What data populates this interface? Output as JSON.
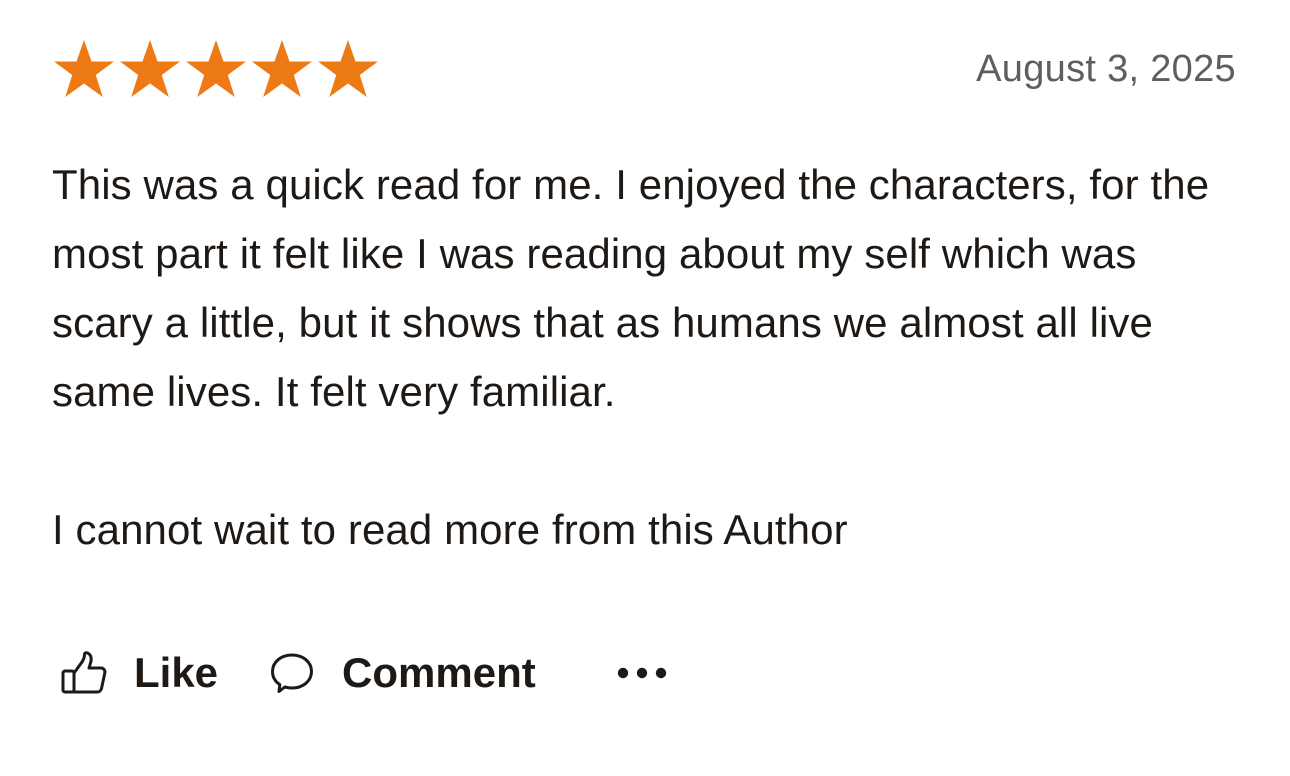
{
  "review": {
    "rating": 5,
    "rating_max": 5,
    "star_color": "#ee7a16",
    "date": "August 3, 2025",
    "paragraphs": [
      "This was a quick read for me. I enjoyed the characters, for the most part it felt like I was reading about my self which was scary a little, but it shows that as humans we almost all live same lives. It felt very familiar.",
      "I cannot wait to read more from this Author"
    ]
  },
  "actions": {
    "like_label": "Like",
    "like_icon": "thumbs-up-icon",
    "comment_label": "Comment",
    "comment_icon": "speech-bubble-icon",
    "more_icon": "more-dots-icon"
  }
}
